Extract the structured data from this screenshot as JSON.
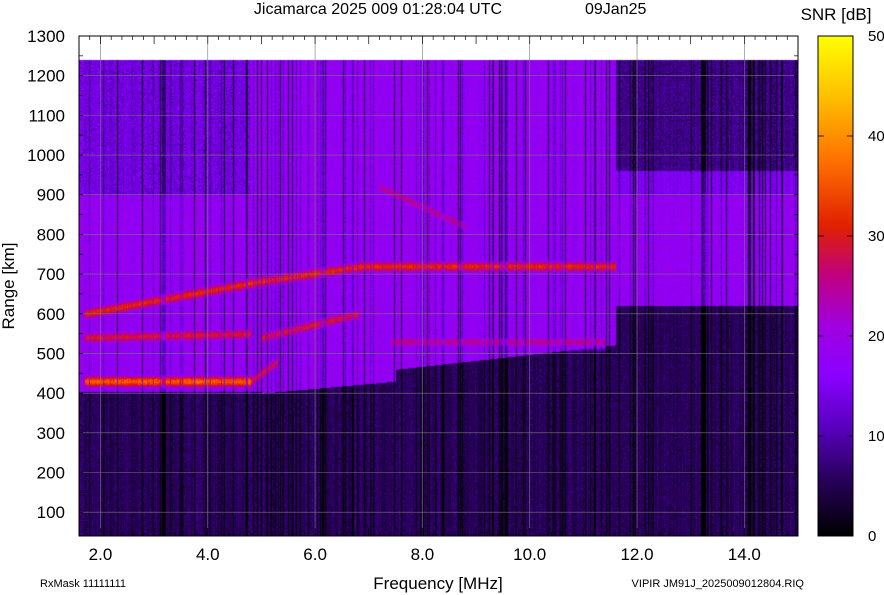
{
  "chart_data": {
    "type": "heatmap",
    "title": "Jicamarca 2025 009 01:28:04 UTC",
    "date_label": "09Jan25",
    "xlabel": "Frequency [MHz]",
    "ylabel": "Range [km]",
    "colorbar_label": "SNR [dB]",
    "xlim": [
      1.6,
      15.0
    ],
    "ylim": [
      40,
      1300
    ],
    "xticks": [
      "2.0",
      "4.0",
      "6.0",
      "8.0",
      "10.0",
      "12.0",
      "14.0"
    ],
    "xtick_values": [
      2,
      4,
      6,
      8,
      10,
      12,
      14
    ],
    "yticks": [
      "100",
      "200",
      "300",
      "400",
      "500",
      "600",
      "700",
      "800",
      "900",
      "1000",
      "1100",
      "1200",
      "1300"
    ],
    "ytick_values": [
      100,
      200,
      300,
      400,
      500,
      600,
      700,
      800,
      900,
      1000,
      1100,
      1200,
      1300
    ],
    "colorbar_ticks": [
      "0",
      "10",
      "20",
      "30",
      "40",
      "50"
    ],
    "colorbar_values": [
      0,
      10,
      20,
      30,
      40,
      50
    ],
    "data_range_km": [
      40,
      1240
    ],
    "grid": true,
    "colormap": [
      "#000000",
      "#3c0090",
      "#8a00ff",
      "#b000b0",
      "#e03000",
      "#ff9000",
      "#ffff00"
    ],
    "echo_traces": [
      {
        "f": [
          1.7,
          4.8
        ],
        "r": [
          430,
          430
        ],
        "snr": 32
      },
      {
        "f": [
          4.8,
          5.3
        ],
        "r": [
          430,
          480
        ],
        "snr": 26
      },
      {
        "f": [
          1.7,
          4.9
        ],
        "r": [
          600,
          680
        ],
        "snr": 28
      },
      {
        "f": [
          4.9,
          6.9
        ],
        "r": [
          680,
          720
        ],
        "snr": 28
      },
      {
        "f": [
          1.7,
          4.8
        ],
        "r": [
          540,
          550
        ],
        "snr": 26
      },
      {
        "f": [
          5.0,
          6.8
        ],
        "r": [
          540,
          600
        ],
        "snr": 26
      },
      {
        "f": [
          6.8,
          11.6
        ],
        "r": [
          720,
          720
        ],
        "snr": 28
      },
      {
        "f": [
          7.4,
          11.4
        ],
        "r": [
          530,
          530
        ],
        "snr": 22
      },
      {
        "f": [
          7.2,
          8.8
        ],
        "r": [
          920,
          820
        ],
        "snr": 22
      }
    ]
  },
  "footer": {
    "rxmask": "RxMask 11111111",
    "file": "VIPIR  JM91J_2025009012804.RIQ"
  }
}
